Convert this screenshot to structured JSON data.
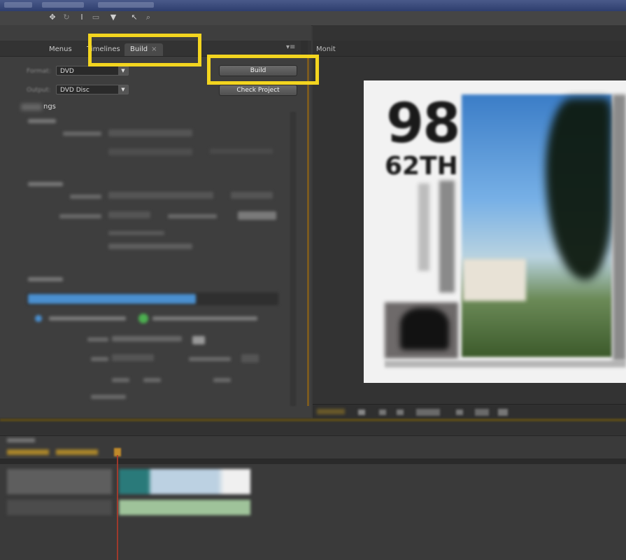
{
  "panel_tabs": {
    "menus": "Menus",
    "timelines": "Timelines",
    "build": "Build",
    "build_close": "×",
    "monitor": "Monit"
  },
  "build_panel": {
    "format_label": "Format:",
    "format_value": "DVD",
    "output_label": "Output:",
    "output_value": "DVD Disc",
    "build_button": "Build",
    "check_project_button": "Check Project",
    "settings_label": "ngs"
  },
  "preview": {
    "big_number": "98",
    "sub_text": "62TH"
  },
  "icons": {
    "move_tool": "✥",
    "text_tool": "I",
    "panel_menu": "▾≡"
  },
  "colors": {
    "highlight": "#f3d51f",
    "progress": "#4a8fcf",
    "playhead": "#c0392b"
  }
}
